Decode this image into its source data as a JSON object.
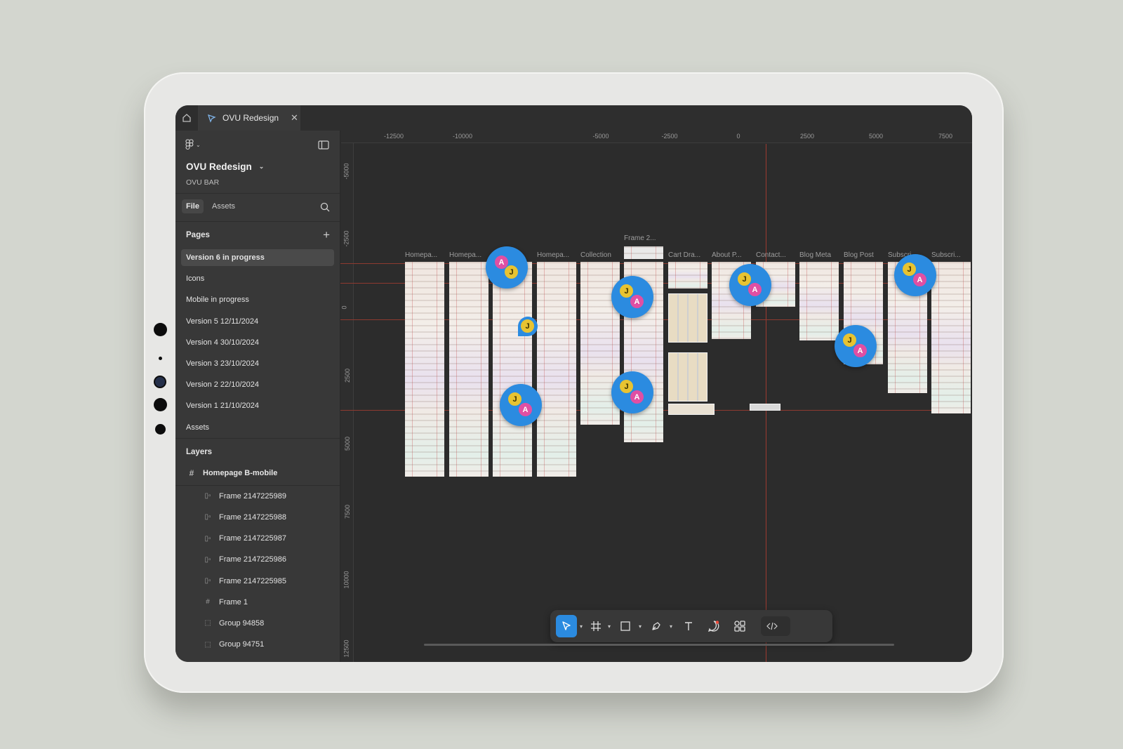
{
  "tabs": {
    "document_tab_label": "OVU Redesign"
  },
  "project": {
    "name": "OVU Redesign",
    "team": "OVU BAR"
  },
  "sidebar": {
    "file_tab": "File",
    "assets_tab": "Assets",
    "pages_title": "Pages",
    "pages": [
      "Version 6 in progress",
      "Icons",
      "Mobile in progress",
      "Version 5 12/11/2024",
      "Version 4 30/10/2024",
      "Version 3 23/10/2024",
      "Version 2 22/10/2024",
      "Version 1 21/10/2024",
      "Assets"
    ],
    "active_page_index": 0,
    "layers_title": "Layers",
    "layer_root": "Homepage B-mobile",
    "layers": [
      "Frame 2147225989",
      "Frame 2147225988",
      "Frame 2147225987",
      "Frame 2147225986",
      "Frame 2147225985",
      "Frame 1",
      "Group 94858",
      "Group 94751"
    ]
  },
  "ruler": {
    "x_ticks": [
      "-12500",
      "-10000",
      "-5000",
      "-2500",
      "0",
      "2500",
      "5000",
      "7500"
    ],
    "y_ticks": [
      "-5000",
      "-2500",
      "0",
      "2500",
      "5000",
      "7500",
      "10000",
      "12500"
    ]
  },
  "canvas": {
    "frame_labels": [
      "Homepa...",
      "Homepa...",
      "Homepa...",
      "Collection",
      "Frame 2...",
      "Cart Dra...",
      "About P...",
      "Contact...",
      "Blog Meta",
      "Blog Post",
      "Subscri...",
      "Subscri..."
    ],
    "cursor_initials": {
      "j": "J",
      "a": "A"
    }
  },
  "toolbar": {
    "tools": [
      "move-tool",
      "frame-tool",
      "shape-tool",
      "pen-tool",
      "text-tool",
      "comment-tool",
      "actions-tool",
      "dev-mode-toggle"
    ]
  },
  "colors": {
    "accent": "#2b8be0",
    "user_j": "#e8c331",
    "user_a": "#e04fa3",
    "guide": "#9c3a30"
  }
}
